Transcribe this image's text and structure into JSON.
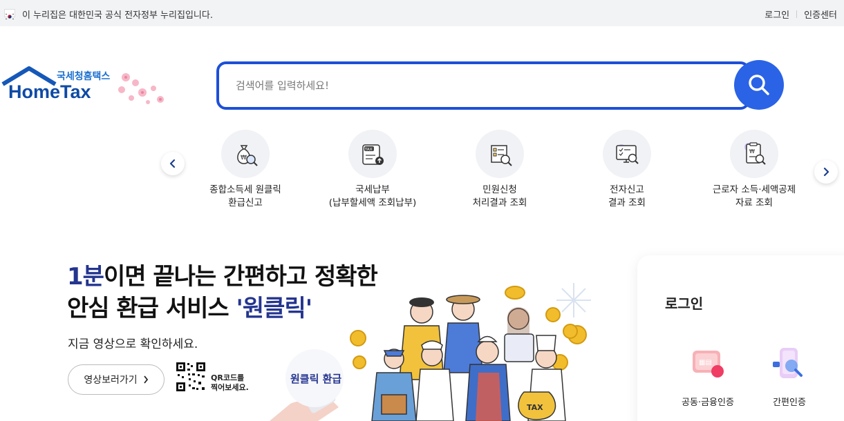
{
  "gov_banner": {
    "text": "이 누리집은 대한민국 공식 전자정부 누리집입니다."
  },
  "top_links": {
    "login": "로그인",
    "cert_center": "인증센터"
  },
  "logo": {
    "sub": "국세청홈택스",
    "main": "HomeTax"
  },
  "search": {
    "placeholder": "검색어를 입력하세요!"
  },
  "quick_menu": [
    {
      "label": "종합소득세 원클릭\n환급신고",
      "icon": "money-bag-search-icon"
    },
    {
      "label": "국세납부\n(납부할세액 조회납부)",
      "icon": "tax-document-upload-icon"
    },
    {
      "label": "민원신청\n처리결과 조회",
      "icon": "document-search-icon"
    },
    {
      "label": "전자신고\n결과 조회",
      "icon": "monitor-checklist-icon"
    },
    {
      "label": "근로자 소득·세액공제\n자료 조회",
      "icon": "receipt-search-icon"
    }
  ],
  "promo": {
    "title_accent": "1분",
    "title_line1_rest": "이면 끝나는 간편하고 정확한",
    "title_line2_pre": "안심 환급 서비스 ",
    "title_line2_accent": "'원클릭'",
    "sub": "지금 영상으로 확인하세요.",
    "video_button": "영상보러가기",
    "qr_text": "QR코드를\n찍어보세요.",
    "badge": "원클릭 환급",
    "tax_sack": "TAX"
  },
  "login_panel": {
    "title": "로그인",
    "options": [
      {
        "label": "공동·금융인증",
        "icon": "certificate-card-icon"
      },
      {
        "label": "간편인증",
        "icon": "phone-search-icon"
      }
    ]
  },
  "colors": {
    "brand_blue": "#1d4fd8",
    "search_button": "#2a63e6",
    "accent_navy": "#24358f"
  }
}
